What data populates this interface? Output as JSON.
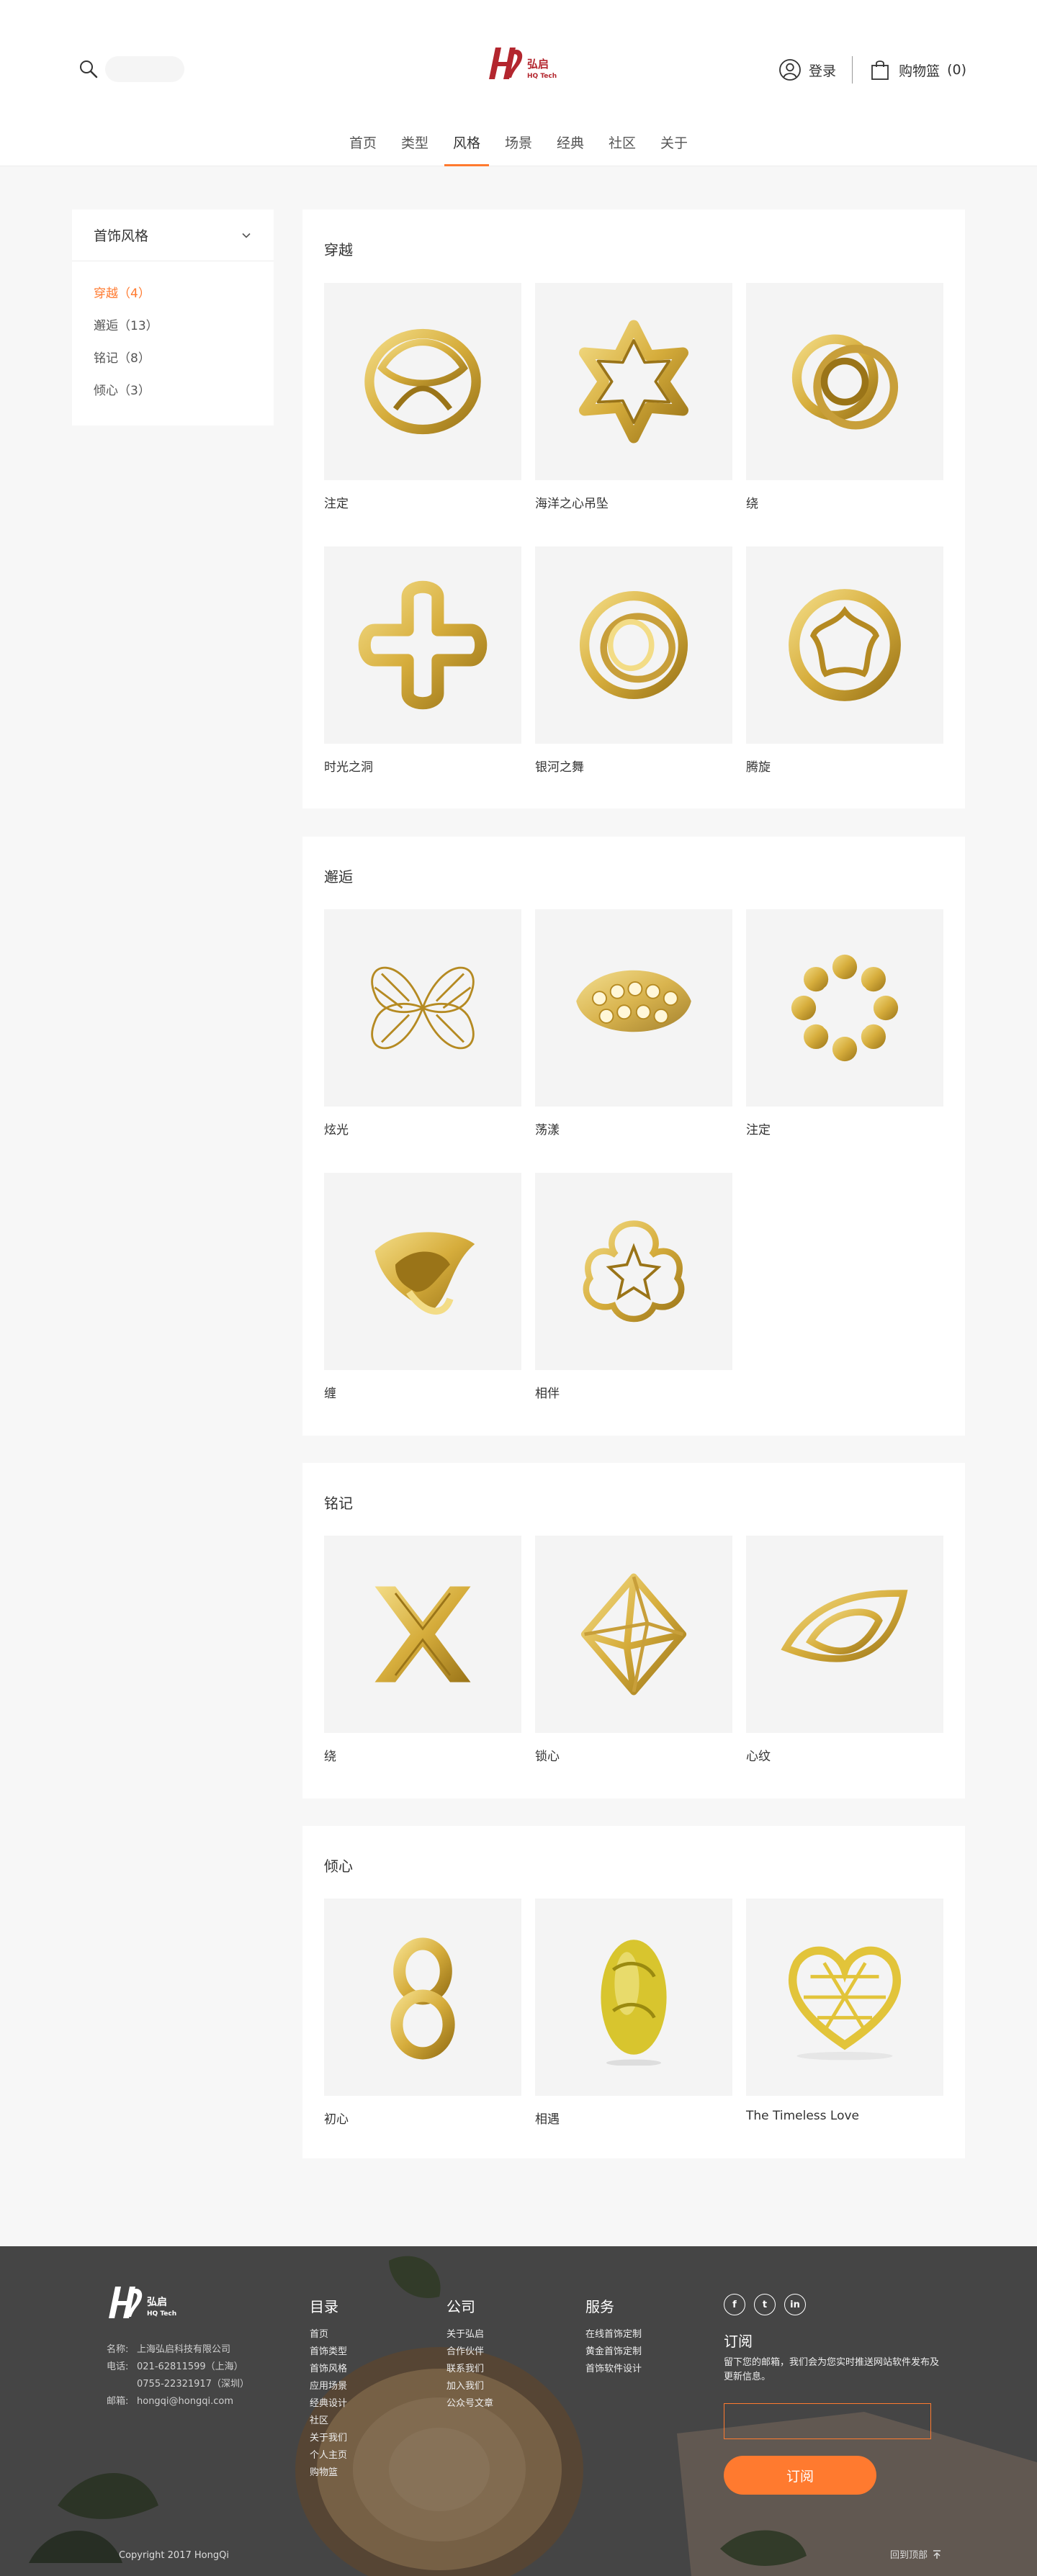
{
  "header": {
    "search_placeholder": "",
    "login_label": "登录",
    "cart_label": "购物篮",
    "cart_count": "(0)",
    "logo_cn": "弘启",
    "logo_en": "HQ Tech"
  },
  "nav": {
    "items": [
      "首页",
      "类型",
      "风格",
      "场景",
      "经典",
      "社区",
      "关于"
    ],
    "active": "风格"
  },
  "sidebar": {
    "title": "首饰风格",
    "items": [
      {
        "label": "穿越（4）",
        "active": true
      },
      {
        "label": "邂逅（13）",
        "active": false
      },
      {
        "label": "铭记（8）",
        "active": false
      },
      {
        "label": "倾心（3）",
        "active": false
      }
    ]
  },
  "sections": [
    {
      "title": "穿越",
      "items": [
        {
          "name": "注定",
          "icon": "ring-knot-icon"
        },
        {
          "name": "海洋之心吊坠",
          "icon": "star-pendant-icon"
        },
        {
          "name": "绕",
          "icon": "wound-ring-icon"
        },
        {
          "name": "时光之洞",
          "icon": "clover-ring-icon"
        },
        {
          "name": "银河之舞",
          "icon": "galaxy-ring-icon"
        },
        {
          "name": "腾旋",
          "icon": "flower-cutout-ring-icon"
        }
      ]
    },
    {
      "title": "邂逅",
      "items": [
        {
          "name": "炫光",
          "icon": "lattice-butterfly-icon"
        },
        {
          "name": "荡漾",
          "icon": "honeycomb-bangle-icon"
        },
        {
          "name": "注定",
          "icon": "wave-flower-ring-icon"
        },
        {
          "name": "缠",
          "icon": "twisted-knot-icon"
        },
        {
          "name": "相伴",
          "icon": "lotus-ring-icon"
        }
      ]
    },
    {
      "title": "铭记",
      "items": [
        {
          "name": "绕",
          "icon": "x-cross-icon"
        },
        {
          "name": "锁心",
          "icon": "octahedron-icon"
        },
        {
          "name": "心纹",
          "icon": "eye-ring-icon"
        }
      ]
    },
    {
      "title": "倾心",
      "items": [
        {
          "name": "初心",
          "icon": "figure-eight-icon"
        },
        {
          "name": "相遇",
          "icon": "carved-bead-icon"
        },
        {
          "name": "The Timeless Love",
          "icon": "lattice-heart-icon"
        }
      ]
    }
  ],
  "footer": {
    "company": [
      {
        "label": "名称:",
        "value": "上海弘启科技有限公司"
      },
      {
        "label": "电话:",
        "value": "021-62811599（上海）"
      },
      {
        "label": "",
        "value": "0755-22321917（深圳）"
      },
      {
        "label": "邮箱:",
        "value": "hongqi@hongqi.com"
      }
    ],
    "columns": [
      {
        "title": "目录",
        "links": [
          "首页",
          "首饰类型",
          "首饰风格",
          "应用场景",
          "经典设计",
          "社区",
          "关于我们",
          "个人主页",
          "购物篮"
        ]
      },
      {
        "title": "公司",
        "links": [
          "关于弘启",
          "合作伙伴",
          "联系我们",
          "加入我们",
          "公众号文章"
        ]
      },
      {
        "title": "服务",
        "links": [
          "在线首饰定制",
          "黄金首饰定制",
          "首饰软件设计"
        ]
      }
    ],
    "social": [
      "f",
      "t",
      "in"
    ],
    "subscribe_title": "订阅",
    "subscribe_desc": "留下您的邮箱，我们会为您实时推送网站软件发布及更新信息。",
    "subscribe_button": "订阅",
    "copyright": "Copyright 2017 HongQi",
    "back_top": "回到顶部"
  },
  "colors": {
    "accent": "#ff7a2f",
    "gold_light": "#f3dc86",
    "gold": "#d6ad3c",
    "gold_dark": "#9a7418",
    "footer_bg": "#5a5a5a"
  }
}
